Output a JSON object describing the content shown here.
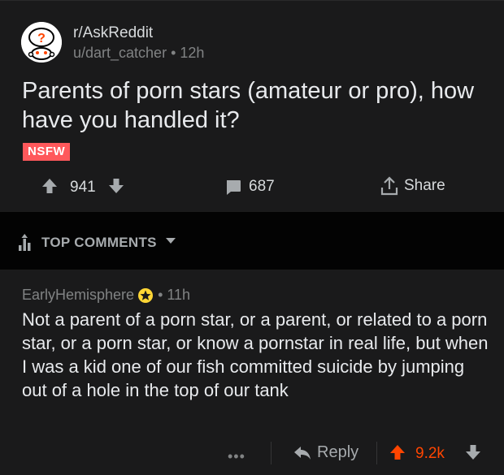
{
  "post": {
    "subreddit": "r/AskReddit",
    "author": "u/dart_catcher",
    "separator": "•",
    "age": "12h",
    "title": "Parents of porn stars (amateur or pro), how have you handled it?",
    "flair": "NSFW",
    "score": "941",
    "comment_count": "687",
    "share_label": "Share"
  },
  "sort": {
    "label": "TOP COMMENTS"
  },
  "comment": {
    "author": "EarlyHemisphere",
    "separator": "•",
    "age": "11h",
    "body": "Not a parent of a porn star, or a parent, or related to a porn star, or a porn star, or know a pornstar in real life, but when I was a kid one of our fish committed suicide by jumping out of a hole in the top of our tank",
    "more_label": "•••",
    "reply_label": "Reply",
    "score": "9.2k"
  },
  "colors": {
    "background": "#000000",
    "card": "#1a1a1b",
    "nsfw": "#ff585b",
    "upvote_active": "#ff4500",
    "award": "#ffd635"
  },
  "icons": [
    "reddit-snoo-question-icon",
    "upvote-icon",
    "downvote-icon",
    "comment-icon",
    "share-icon",
    "sort-top-icon",
    "caret-down-icon",
    "award-icon",
    "reply-icon"
  ]
}
